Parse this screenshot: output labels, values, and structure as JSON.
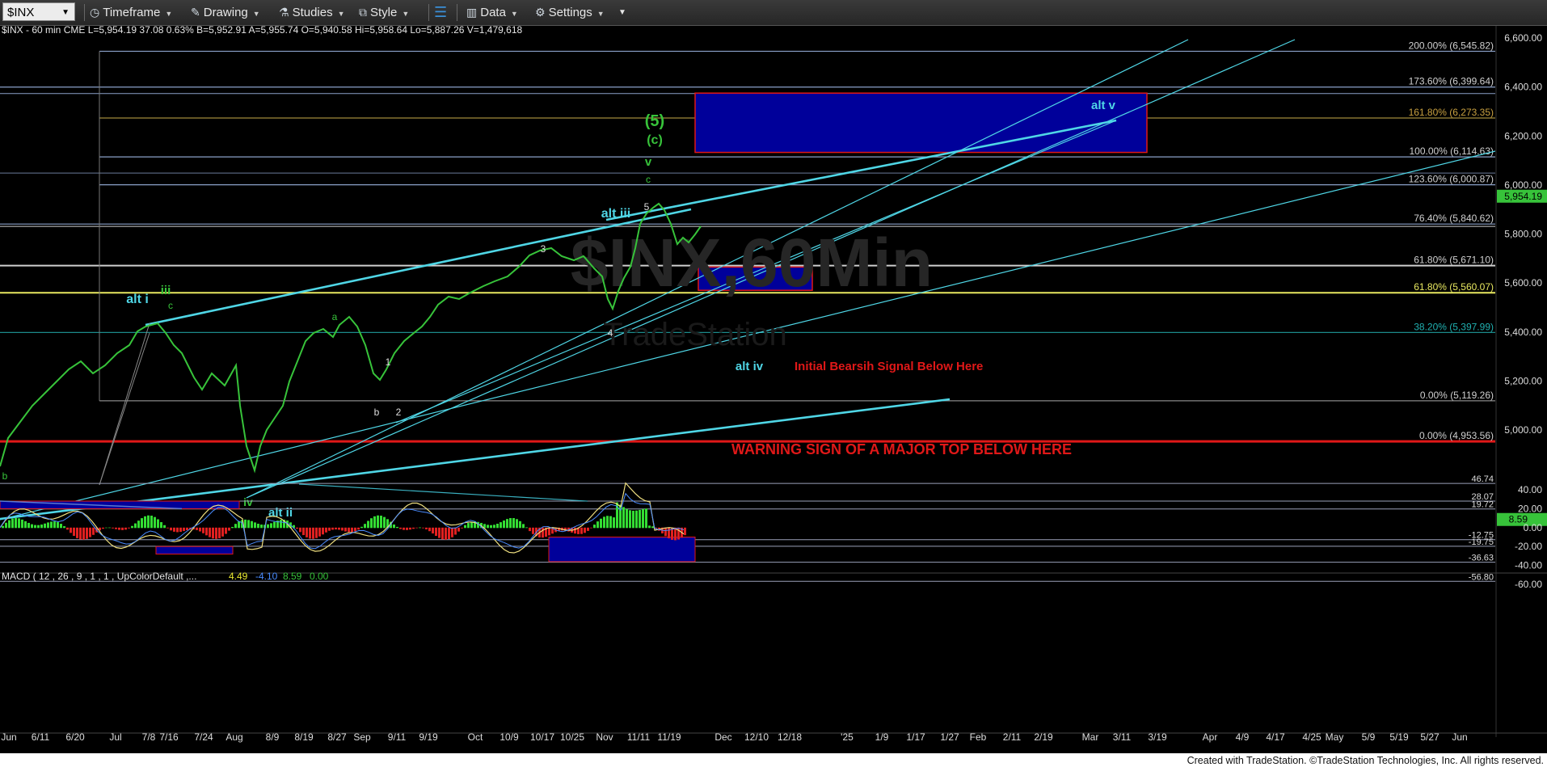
{
  "toolbar": {
    "symbol": "$INX",
    "timeframe": "Timeframe",
    "drawing": "Drawing",
    "studies": "Studies",
    "style": "Style",
    "data": "Data",
    "settings": "Settings"
  },
  "header": {
    "text": "$INX - 60 min  CME  L=5,954.19  37.08  0.63%  B=5,952.91  A=5,955.74  O=5,940.58  Hi=5,958.64  Lo=5,887.26  V=1,479,618"
  },
  "watermark": {
    "line1": "$INX,60Min",
    "line2": "TradeStation"
  },
  "footer": "Created with TradeStation. ©TradeStation Technologies, Inc. All rights reserved.",
  "colors": {
    "background": "#000000",
    "cyan": "#4fd6e6",
    "green": "#37c33a",
    "red": "#e01818",
    "blue_box": "#00009a",
    "yellow": "#e8e89a"
  },
  "chart_data": [
    {
      "type": "line",
      "name": "$INX - 60 min",
      "y_axis": {
        "ticks": [
          6600,
          6400,
          6200,
          6000,
          5800,
          5600,
          5400,
          5200,
          5000
        ],
        "labels": [
          "6,600.00",
          "6,400.00",
          "6,200.00",
          "6,000.00",
          "5,800.00",
          "5,600.00",
          "5,400.00",
          "5,200.00",
          "5,000.00"
        ],
        "range": [
          4905,
          6625
        ]
      },
      "x_axis": {
        "labels": [
          "Jun",
          "6/11",
          "6/20",
          "Jul",
          "7/8",
          "7/16",
          "7/24",
          "Aug",
          "8/9",
          "8/19",
          "8/27",
          "Sep",
          "9/11",
          "9/19",
          "Oct",
          "10/9",
          "10/17",
          "10/25",
          "Nov",
          "11/11",
          "11/19",
          "Dec",
          "12/10",
          "12/18",
          "'25",
          "1/9",
          "1/17",
          "1/27",
          "Feb",
          "2/11",
          "2/19",
          "Mar",
          "3/11",
          "3/19",
          "Apr",
          "4/9",
          "4/17",
          "4/25",
          "May",
          "5/9",
          "5/19",
          "5/27",
          "Jun"
        ]
      },
      "last_price": "5,954.19",
      "fib_levels": [
        {
          "label": "200.00% (6,545.82)",
          "value": 6545.82
        },
        {
          "label": "173.60% (6,399.64)",
          "value": 6399.64
        },
        {
          "label": "161.80% (6,273.35)",
          "value": 6273.35
        },
        {
          "label": "100.00% (6,114.63)",
          "value": 6114.63
        },
        {
          "label": "123.60% (6,000.87)",
          "value": 6000.87
        },
        {
          "label": "76.40% (5,840.62)",
          "value": 5840.62
        },
        {
          "label": "61.80% (5,671.10)",
          "value": 5671.1
        },
        {
          "label": "61.80% (5,560.07)",
          "value": 5560.07
        },
        {
          "label": "38.20% (5,397.99)",
          "value": 5397.99
        },
        {
          "label": "0.00% (5,119.26)",
          "value": 5119.26
        },
        {
          "label": "0.00% (4,953.56)",
          "value": 4953.56
        }
      ],
      "wave_labels": [
        "alt i",
        "iii",
        "c",
        "b",
        "iv",
        "alt ii",
        "a",
        "b",
        "1",
        "2",
        "3",
        "4",
        "5",
        "alt iii",
        "(5)",
        "(c)",
        "v",
        "c",
        "alt iv",
        "alt v"
      ],
      "annotations": [
        "Initial Bearsih Signal Below Here",
        "WARNING SIGN OF A MAJOR TOP BELOW HERE"
      ]
    },
    {
      "type": "line",
      "name": "MACD",
      "header": "MACD ( 12 , 26 , 9 , 1 , 1 , UpColorDefault ,...",
      "readouts": [
        "4.49",
        "-4.10",
        "8.59",
        "0.00"
      ],
      "y_axis": {
        "ticks": [
          40,
          20,
          0,
          -20,
          -40,
          -60
        ],
        "labels": [
          "40.00",
          "20.00",
          "0.00",
          "-20.00",
          "-40.00",
          "-60.00"
        ],
        "range": [
          -65,
          50
        ]
      },
      "levels": [
        "46.74",
        "28.07",
        "19.72",
        "-12.75",
        "-19.75",
        "-36.63",
        "-56.80"
      ],
      "last_value": "8.59"
    }
  ]
}
